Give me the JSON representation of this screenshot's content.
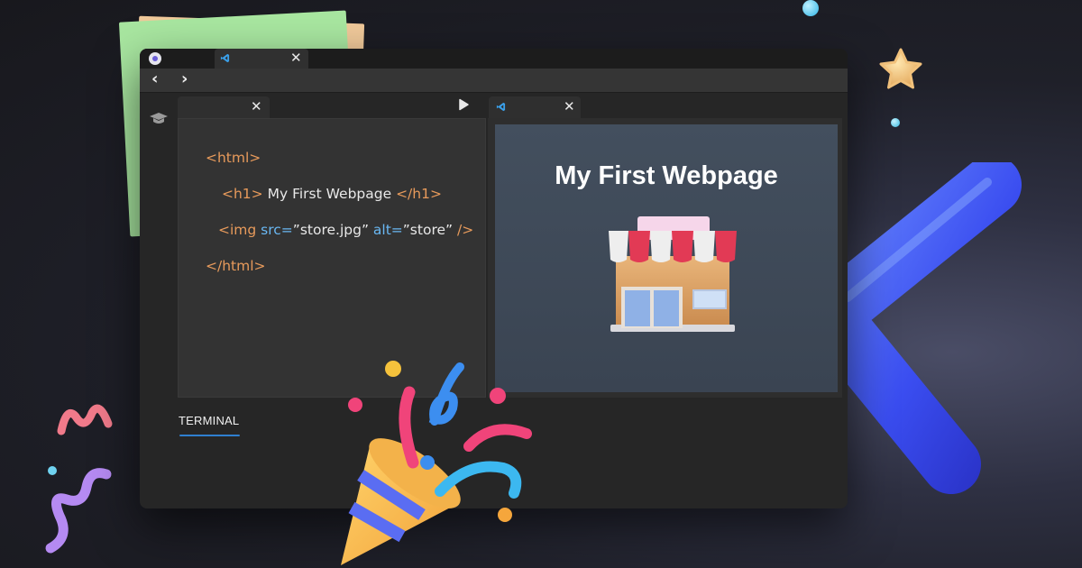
{
  "tabs": [
    {
      "name": "home",
      "active": false
    },
    {
      "name": "vscode",
      "active": true,
      "close": "✕"
    }
  ],
  "editor": {
    "close": "✕",
    "lines": [
      {
        "open": "<html>",
        "text": "",
        "close": ""
      },
      {
        "open": "<h1>",
        "text": " My First Webpage ",
        "close": "</h1>"
      },
      {
        "open": "<img ",
        "attr1": "src=",
        "val1": "”store.jpg”",
        "attr2": " alt=",
        "val2": "”store”",
        "close": " />"
      },
      {
        "open": "</html>",
        "text": "",
        "close": ""
      }
    ]
  },
  "preview": {
    "close": "✕",
    "title": "My First Webpage"
  },
  "terminal": {
    "label": "TERMINAL"
  },
  "colors": {
    "tag": "#e79a5b",
    "attribute": "#69b7f2",
    "accent": "#2f7fd0",
    "window_bg": "#262626"
  },
  "icons": [
    "home-icon",
    "vscode-icon",
    "close-icon",
    "chevron-left-icon",
    "chevron-right-icon",
    "graduation-cap-icon",
    "run-icon",
    "store-icon"
  ]
}
